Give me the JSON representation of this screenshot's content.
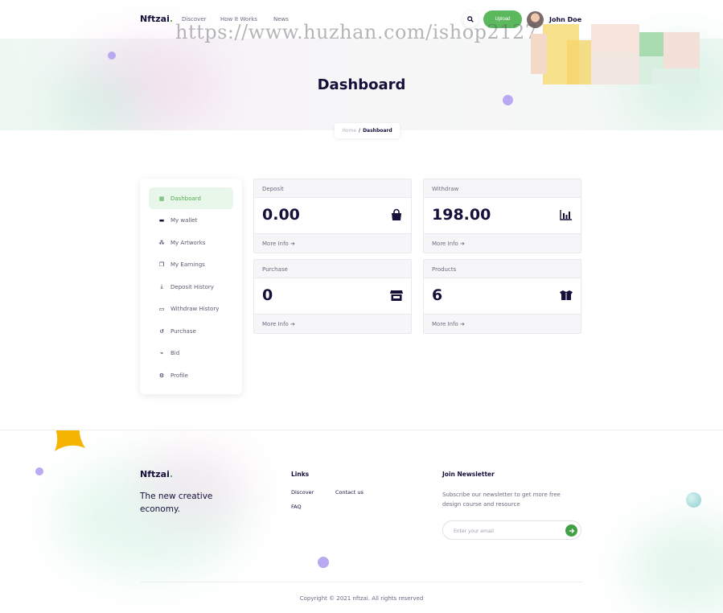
{
  "header": {
    "logo_text": "Nftzai",
    "logo_dot": ".",
    "nav": [
      "Discover",
      "How It Works",
      "News"
    ],
    "upload_label": "Upload",
    "user_name": "John Doe",
    "watermark": "https://www.huzhan.com/ishop2127"
  },
  "hero": {
    "title": "Dashboard",
    "breadcrumb": {
      "home": "Home",
      "separator": "/",
      "current": "Dashboard"
    }
  },
  "sidebar": {
    "items": [
      {
        "label": "Dashboard",
        "icon": "grid-icon",
        "active": true
      },
      {
        "label": "My wallet",
        "icon": "wallet-icon"
      },
      {
        "label": "My Artworks",
        "icon": "artworks-icon"
      },
      {
        "label": "My Earnings",
        "icon": "earnings-icon"
      },
      {
        "label": "Deposit History",
        "icon": "deposit-icon"
      },
      {
        "label": "Withdraw History",
        "icon": "withdraw-icon"
      },
      {
        "label": "Purchase",
        "icon": "purchase-icon"
      },
      {
        "label": "Bid",
        "icon": "bid-chart-icon"
      },
      {
        "label": "Profile",
        "icon": "profile-gear-icon"
      }
    ]
  },
  "cards": [
    {
      "title": "Deposit",
      "value": "0.00",
      "icon": "shopping-bag-icon",
      "more": "More Info ➔"
    },
    {
      "title": "Withdraw",
      "value": "198.00",
      "icon": "bar-chart-icon",
      "more": "More Info ➔"
    },
    {
      "title": "Purchase",
      "value": "0",
      "icon": "store-icon",
      "more": "More Info ➔"
    },
    {
      "title": "Products",
      "value": "6",
      "icon": "open-box-icon",
      "more": "More Info ➔"
    }
  ],
  "footer": {
    "logo_text": "Nftzai",
    "logo_dot": ".",
    "tagline": "The new creative economy.",
    "links_heading": "Links",
    "links": [
      "Discover",
      "Contact us",
      "FAQ"
    ],
    "newsletter_heading": "Join Newsletter",
    "newsletter_text": "Subscribe our newsletter to get more free design course and resource",
    "email_placeholder": "Enter your email",
    "copyright": "Copyright © 2021 nftzai. All rights reserved"
  },
  "colors": {
    "accent": "#4caf50",
    "text": "#14103a",
    "muted": "#6b6b80",
    "star": "#f5b400",
    "dot": "#b8a9f0"
  }
}
